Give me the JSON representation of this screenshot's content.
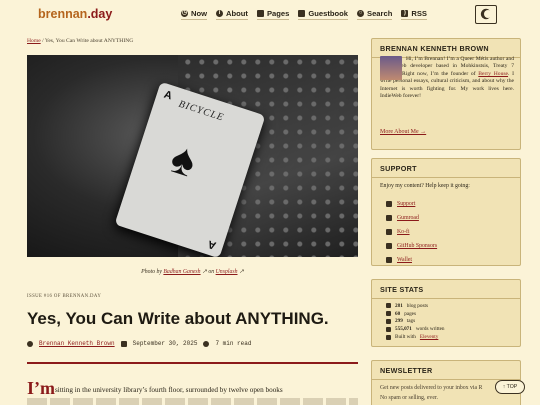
{
  "site": {
    "logo_main": "brennan",
    "logo_tld": ".day"
  },
  "nav": [
    {
      "label": "Now",
      "icon": "clock-icon"
    },
    {
      "label": "About",
      "icon": "info-icon"
    },
    {
      "label": "Pages",
      "icon": "pages-icon"
    },
    {
      "label": "Guestbook",
      "icon": "guestbook-icon"
    },
    {
      "label": "Search",
      "icon": "search-icon"
    },
    {
      "label": "RSS",
      "icon": "rss-icon"
    }
  ],
  "breadcrumb": {
    "home": "Home",
    "separator": "/",
    "current": "Yes, You Can Write about ANYTHING"
  },
  "photo": {
    "prefix": "Photo by",
    "author": "Badhan Ganesh",
    "middle": "on",
    "source": "Unsplash",
    "card_brand": "BICYCLE",
    "card_rank": "A"
  },
  "article": {
    "issue": "ISSUE #16 OF BRENNAN.DAY",
    "title": "Yes, You Can Write about ANYTHING.",
    "author": "Brennan Kenneth Brown",
    "date": "September 30, 2025",
    "read_time": "7 min read",
    "dropcap": "I’m",
    "lead": "sitting in the university library’s fourth floor, surrounded by twelve open books"
  },
  "sidebar": {
    "about": {
      "title": "BRENNAN KENNETH BROWN",
      "bio_before": "Hi, I’m Brennan! I’m a Queer Métis author and FOSS web developer based in Mohkinstsis, Treaty 7 territory. Right now, I’m the founder of",
      "berry": "Berry House",
      "bio_after": ". I write personal essays, cultural criticism, and about why the Internet is worth fighting for. My work lives here. IndieWeb forever!",
      "more": "More About Me →"
    },
    "support": {
      "title": "SUPPORT",
      "intro": "Enjoy my content? Help keep it going:",
      "links": [
        "Support",
        "Gumroad",
        "Ko-fi",
        "GitHub Sponsors",
        "Wallet"
      ]
    },
    "stats": {
      "title": "SITE STATS",
      "rows": [
        {
          "value": "281",
          "label": "blog posts"
        },
        {
          "value": "60",
          "label": "pages"
        },
        {
          "value": "299",
          "label": "tags"
        },
        {
          "value": "555,071",
          "label": "words written"
        }
      ],
      "built_prefix": "Built with",
      "built_tool": "Eleventy"
    },
    "newsletter": {
      "title": "NEWSLETTER",
      "line1": "Get new posts delivered to your inbox via R",
      "line2": "No spam or selling, ever."
    }
  },
  "top_button": "↑ TOP",
  "colors": {
    "background": "#fbf3d7",
    "accent": "#8b1a1a",
    "logo": "#b5651d",
    "sidebar_box": "#f1e3b5"
  }
}
